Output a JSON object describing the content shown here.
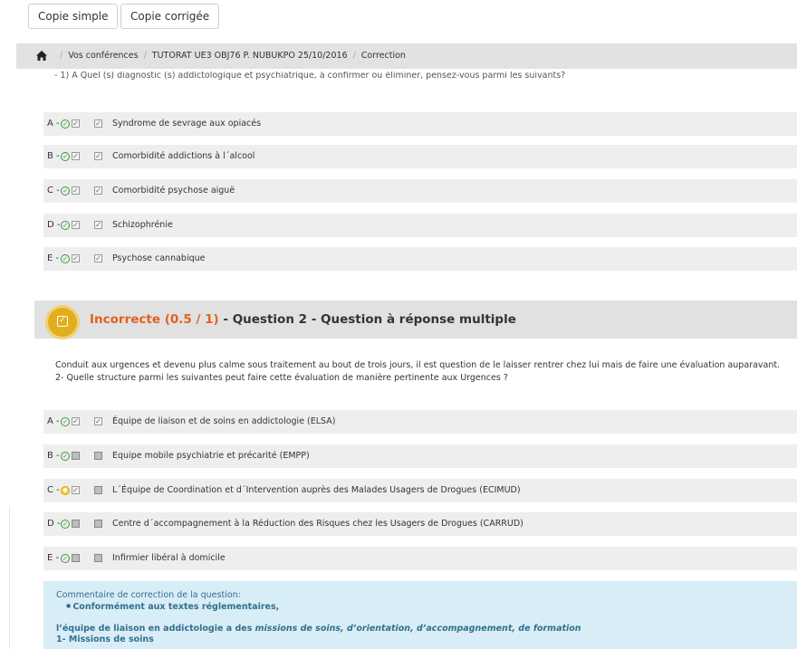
{
  "toolbar": {
    "copie_simple": "Copie simple",
    "copie_corrigee": "Copie corrigée"
  },
  "breadcrumb": {
    "items": [
      "Vos conférences",
      "TUTORAT UE3 OBJ76 P. NUBUKPO 25/10/2016",
      "Correction"
    ]
  },
  "question1": {
    "cut_text": "- 1) A Quel (s) diagnostic (s) addictologique et psychiatrique, à confirmer ou éliminer, pensez-vous parmi les suivants?",
    "answers": [
      {
        "letter": "A -",
        "text": "Syndrome de sevrage aux opiacés",
        "correct": true,
        "checked": true
      },
      {
        "letter": "B -",
        "text": "Comorbidité addictions à l´alcool",
        "correct": true,
        "checked": true
      },
      {
        "letter": "C -",
        "text": "Comorbidité psychose aiguë",
        "correct": true,
        "checked": true
      },
      {
        "letter": "D -",
        "text": "Schizophrénie",
        "correct": true,
        "checked": true
      },
      {
        "letter": "E -",
        "text": "Psychose cannabique",
        "correct": true,
        "checked": true
      }
    ]
  },
  "question2": {
    "status": "Incorrecte (0.5 / 1)",
    "title": " - Question 2 - Question à réponse multiple",
    "text_line1": "Conduit aux urgences et devenu plus calme sous traitement au bout de trois jours, il est question de le laisser rentrer chez lui mais de faire une évaluation auparavant.",
    "text_line2": "2- Quelle structure  parmi les suivantes peut faire cette évaluation de manière pertinente aux Urgences ?",
    "answers": [
      {
        "letter": "A -",
        "text": "Équipe de liaison et de soins en addictologie (ELSA)",
        "icon": "ok",
        "expected": true,
        "checked": true
      },
      {
        "letter": "B -",
        "text": "Equipe mobile psychiatrie et précarité (EMPP)",
        "icon": "ok",
        "expected": false,
        "checked": false
      },
      {
        "letter": "C -",
        "text": "L´Équipe de Coordination et d´Intervention auprès des Malades Usagers de Drogues (ECIMUD)",
        "icon": "warn",
        "expected": true,
        "checked": false
      },
      {
        "letter": "D -",
        "text": "Centre d´accompagnement à la Réduction des Risques chez les Usagers de Drogues (CARRUD)",
        "icon": "ok",
        "expected": false,
        "checked": false
      },
      {
        "letter": "E -",
        "text": "Infirmier libéral à domicile",
        "icon": "ok",
        "expected": false,
        "checked": false
      }
    ],
    "comment": {
      "label": "Commentaire de correction de la question:",
      "bullet": "Conformément aux textes réglementaires,",
      "body_start": "l’équipe de liaison en addictologie a des ",
      "body_italic": "missions de soins, d’orientation, d’accompagnement, de formation",
      "cut_line": "1- Missions de soins"
    }
  },
  "colors": {
    "status_incorrect": "#e4601e",
    "badge": "#e0ae1e",
    "ok_icon": "#3a9a3a",
    "comment_bg": "#d9edf7",
    "comment_text": "#31708f"
  }
}
